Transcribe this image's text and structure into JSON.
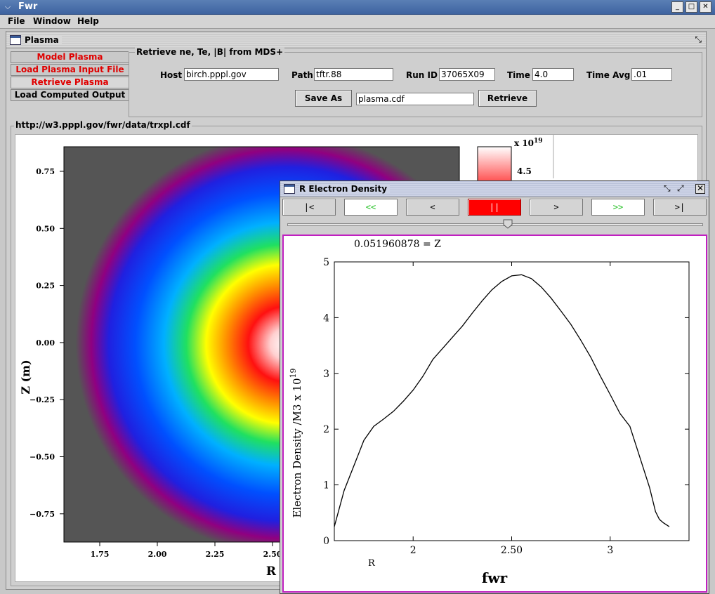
{
  "app": {
    "title": "Fwr"
  },
  "window_buttons": {
    "minimize": "_",
    "maximize": "□",
    "close": "✕"
  },
  "menu": [
    "File",
    "Window",
    "Help"
  ],
  "plasma_frame": {
    "title": "Plasma",
    "tabs": [
      {
        "label": "Model Plasma",
        "color": "#e00000"
      },
      {
        "label": "Load Plasma Input File",
        "color": "#e00000"
      },
      {
        "label": "Retrieve Plasma",
        "color": "#e00000"
      },
      {
        "label": "Load Computed Output",
        "color": "#000000"
      }
    ],
    "retrieve": {
      "legend": "Retrieve ne, Te, |B| from MDS+",
      "host_label": "Host",
      "host_value": "birch.pppl.gov",
      "path_label": "Path",
      "path_value": "tftr.88",
      "runid_label": "Run ID",
      "runid_value": "37065X09",
      "time_label": "Time",
      "time_value": "4.0",
      "timeavg_label": "Time Avg",
      "timeavg_value": ".01",
      "saveas_button": "Save As",
      "saveas_value": "plasma.cdf",
      "retrieve_button": "Retrieve"
    },
    "url_legend": "http://w3.pppl.gov/fwr/data/trxpl.cdf",
    "contour": {
      "ylabel": "Z (m)",
      "xlabel": "R",
      "yticks": [
        "0.75",
        "0.50",
        "0.25",
        "0.00",
        "−0.25",
        "−0.50",
        "−0.75"
      ],
      "xticks": [
        "1.75",
        "2.00",
        "2.25",
        "2.50"
      ],
      "colorbar_unit": "x 10",
      "colorbar_exp": "19",
      "colorbar_top": "4.5"
    }
  },
  "density_window": {
    "title": "R Electron Density",
    "nav_buttons": [
      "|<",
      "<<",
      "<",
      "||",
      ">",
      ">>",
      ">|"
    ],
    "slider_position": 0.53,
    "chart_data": {
      "type": "line",
      "title": "0.051960878  = Z",
      "xlabel": "fwr",
      "ylabel": "Electron Density  /M3  x 10",
      "ylabel_exp": "19",
      "axis_corner_label": "R",
      "xlim": [
        1.6,
        3.4
      ],
      "ylim": [
        0,
        5
      ],
      "xticks": [
        2,
        2.5,
        3
      ],
      "xtick_labels": [
        "2",
        "2.50",
        "3"
      ],
      "yticks": [
        0,
        1,
        2,
        3,
        4,
        5
      ],
      "ytick_labels": [
        "0",
        "1",
        "2",
        "3",
        "4",
        "5"
      ],
      "series": [
        {
          "x": [
            1.6,
            1.65,
            1.7,
            1.75,
            1.8,
            1.85,
            1.9,
            1.95,
            2.0,
            2.05,
            2.1,
            2.15,
            2.2,
            2.25,
            2.3,
            2.35,
            2.4,
            2.45,
            2.5,
            2.55,
            2.6,
            2.65,
            2.7,
            2.75,
            2.8,
            2.85,
            2.9,
            2.95,
            3.0,
            3.05,
            3.1,
            3.15,
            3.2,
            3.23,
            3.25,
            3.27,
            3.3
          ],
          "y": [
            0.25,
            0.9,
            1.35,
            1.8,
            2.05,
            2.18,
            2.32,
            2.5,
            2.7,
            2.95,
            3.25,
            3.45,
            3.65,
            3.85,
            4.08,
            4.3,
            4.5,
            4.65,
            4.75,
            4.77,
            4.7,
            4.55,
            4.35,
            4.12,
            3.88,
            3.6,
            3.3,
            2.95,
            2.62,
            2.28,
            2.05,
            1.5,
            0.95,
            0.52,
            0.38,
            0.32,
            0.25
          ]
        }
      ]
    }
  }
}
